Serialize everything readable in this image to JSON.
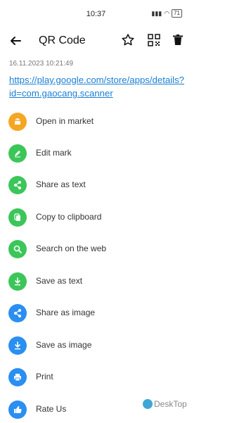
{
  "status": {
    "time": "10:37",
    "battery": "71"
  },
  "toolbar": {
    "title": "QR Code",
    "icons": [
      "back-arrow-icon",
      "star-icon",
      "qr-code-icon",
      "trash-icon"
    ]
  },
  "record": {
    "date": "16.11.2023 10:21:49",
    "content": "https://play.google.com/store/apps/details?id=com.gaocang.scanner"
  },
  "actions": [
    {
      "label": "Open in market",
      "icon": "android-icon",
      "color": "#f5a623"
    },
    {
      "label": "Edit mark",
      "icon": "pencil-icon",
      "color": "#3cc65a"
    },
    {
      "label": "Share as text",
      "icon": "share-icon",
      "color": "#3cc65a"
    },
    {
      "label": "Copy to clipboard",
      "icon": "copy-icon",
      "color": "#3cc65a"
    },
    {
      "label": "Search on the web",
      "icon": "search-icon",
      "color": "#3cc65a"
    },
    {
      "label": "Save as text",
      "icon": "download-icon",
      "color": "#3cc65a"
    },
    {
      "label": "Share as image",
      "icon": "share-icon",
      "color": "#2a8ff0"
    },
    {
      "label": "Save as image",
      "icon": "download-icon",
      "color": "#2a8ff0"
    },
    {
      "label": "Print",
      "icon": "print-icon",
      "color": "#2a8ff0"
    },
    {
      "label": "Rate Us",
      "icon": "thumbs-up-icon",
      "color": "#2a8ff0"
    }
  ],
  "watermark": {
    "text": "DeskTop"
  }
}
